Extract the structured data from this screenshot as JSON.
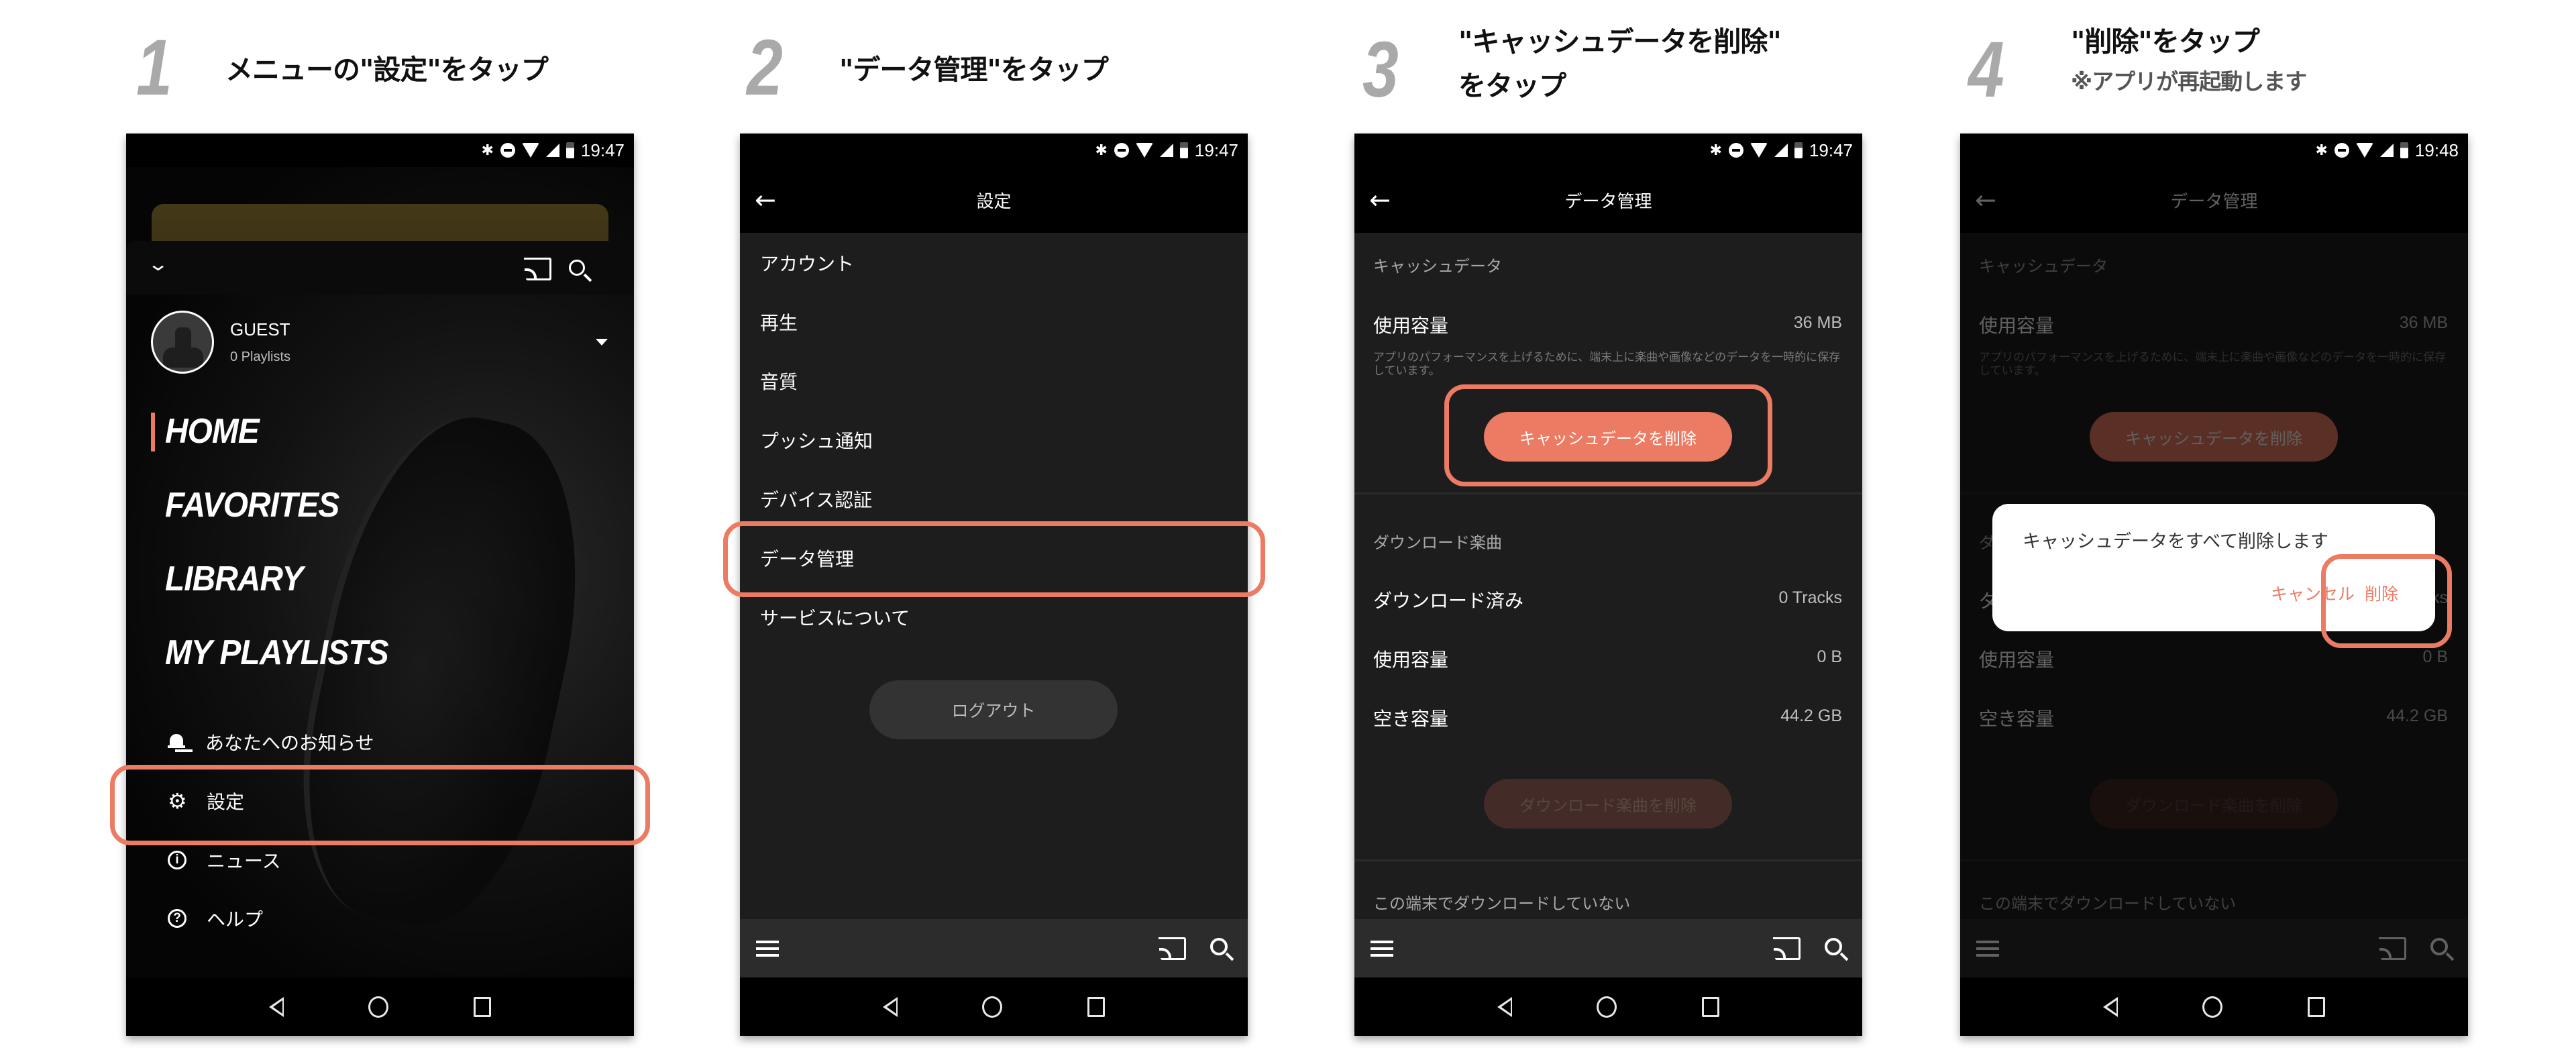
{
  "steps": [
    {
      "number": "1",
      "title": "メニューの\"設定\"をタップ"
    },
    {
      "number": "2",
      "title": "\"データ管理\"をタップ"
    },
    {
      "number": "3",
      "title_line1": "\"キャッシュデータを削除\"",
      "title_line2": "をタップ"
    },
    {
      "number": "4",
      "title": "\"削除\"をタップ",
      "subtitle": "※アプリが再起動します"
    }
  ],
  "status_bar": {
    "time_1": "19:47",
    "time_2": "19:47",
    "time_3": "19:47",
    "time_4": "19:48"
  },
  "colors": {
    "accent": "#ec7b63",
    "highlight": "#ec7b63",
    "background_dark": "#1d1d1d",
    "toolbar": "#2c2c2c"
  },
  "phone1": {
    "user": {
      "name": "GUEST",
      "playlists": "0 Playlists"
    },
    "main_menu": [
      "HOME",
      "FAVORITES",
      "LIBRARY",
      "MY PLAYLISTS"
    ],
    "active_item": "HOME",
    "sub_menu": [
      {
        "icon": "bell-icon",
        "label": "あなたへのお知らせ"
      },
      {
        "icon": "gear-icon",
        "label": "設定"
      },
      {
        "icon": "info-icon",
        "label": "ニュース"
      },
      {
        "icon": "help-icon",
        "label": "ヘルプ"
      }
    ]
  },
  "phone2": {
    "title": "設定",
    "items": [
      "アカウント",
      "再生",
      "音質",
      "プッシュ通知",
      "デバイス認証",
      "データ管理",
      "サービスについて"
    ],
    "logout": "ログアウト"
  },
  "data_mgmt": {
    "title": "データ管理",
    "cache_section": "キャッシュデータ",
    "cache_used_label": "使用容量",
    "cache_used_value": "36 MB",
    "cache_desc": "アプリのパフォーマンスを上げるために、端末上に楽曲や画像などのデータを一時的に保存しています。",
    "cache_delete_btn": "キャッシュデータを削除",
    "download_section": "ダウンロード楽曲",
    "downloaded_label": "ダウンロード済み",
    "downloaded_value": "0 Tracks",
    "dl_used_label": "使用容量",
    "dl_used_value": "0 B",
    "free_label": "空き容量",
    "free_value": "44.2 GB",
    "dl_delete_btn": "ダウンロード楽曲を削除",
    "not_downloaded_section": "この端末でダウンロードしていない"
  },
  "dialog": {
    "message": "キャッシュデータをすべて削除します",
    "cancel": "キャンセル",
    "delete": "削除"
  }
}
